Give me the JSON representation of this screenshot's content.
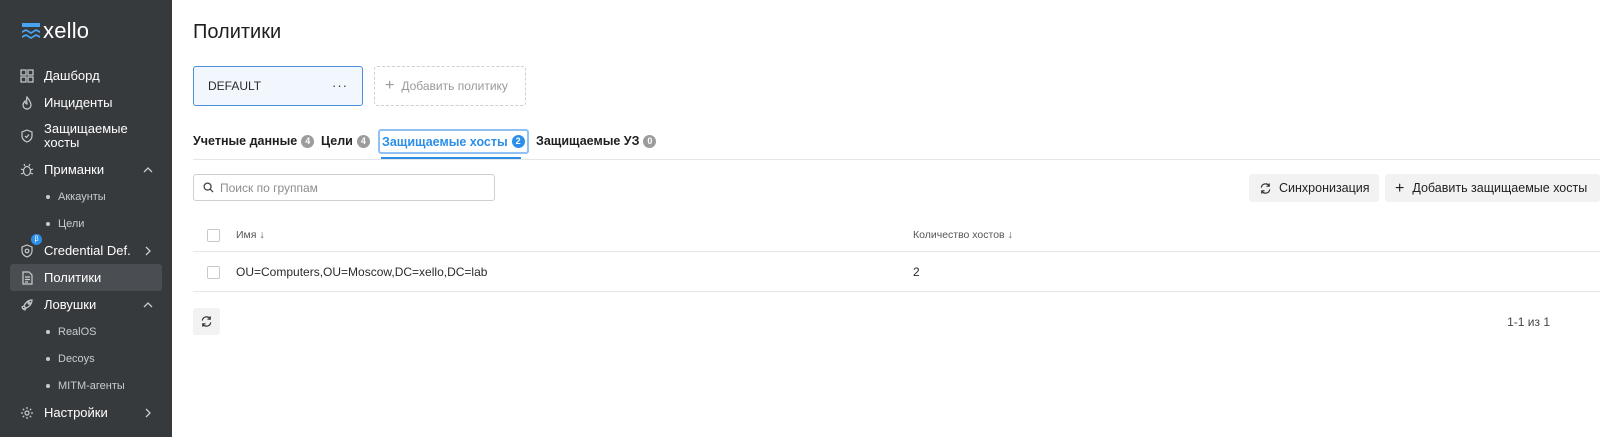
{
  "app": {
    "logo_text": "xello"
  },
  "sidebar": {
    "items": [
      {
        "label": "Дашборд",
        "icon": "dashboard-icon"
      },
      {
        "label": "Инциденты",
        "icon": "flame-icon"
      },
      {
        "label": "Защищаемые хосты",
        "icon": "shield-icon"
      },
      {
        "label": "Приманки",
        "icon": "bug-icon",
        "expanded": true,
        "children": [
          "Аккаунты",
          "Цели"
        ]
      },
      {
        "label": "Credential Def.",
        "icon": "shield-check-icon",
        "badge": "β"
      },
      {
        "label": "Политики",
        "icon": "document-icon",
        "active": true
      },
      {
        "label": "Ловушки",
        "icon": "rocket-icon",
        "expanded": true,
        "children": [
          "RealOS",
          "Decoys",
          "MITM-агенты"
        ]
      },
      {
        "label": "Настройки",
        "icon": "gear-icon"
      }
    ]
  },
  "page": {
    "title": "Политики"
  },
  "policies": {
    "selected": "DEFAULT",
    "more_label": "···",
    "add_label": "Добавить политику"
  },
  "tabs": [
    {
      "label": "Учетные данные",
      "count": "4"
    },
    {
      "label": "Цели",
      "count": "4"
    },
    {
      "label": "Защищаемые хосты",
      "count": "2",
      "active": true
    },
    {
      "label": "Защищаемые УЗ",
      "count": "0"
    }
  ],
  "toolbar": {
    "search_placeholder": "Поиск по группам",
    "sync_label": "Синхронизация",
    "add_hosts_label": "Добавить защищаемые хосты"
  },
  "table": {
    "columns": [
      "Имя ↓",
      "Количество хостов ↓"
    ],
    "rows": [
      {
        "name": "OU=Computers,OU=Moscow,DC=xello,DC=lab",
        "count": "2"
      }
    ]
  },
  "pagination": {
    "text": "1-1 из 1"
  },
  "colors": {
    "sidebar_bg": "#363a3d",
    "accent": "#2b8ee8"
  }
}
